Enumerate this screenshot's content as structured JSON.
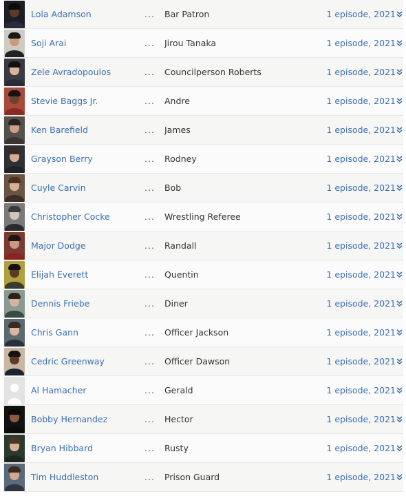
{
  "cast": [
    {
      "name": "Lola Adamson",
      "character": "Bar Patron",
      "episodes": "1 episode, 2021",
      "photo": {
        "bg": "#1e1c24",
        "skin": "#5a3a28",
        "hair": "#0d0b0c",
        "clothes": "#2a2a3a"
      }
    },
    {
      "name": "Soji Arai",
      "character": "Jirou Tanaka",
      "episodes": "1 episode, 2021",
      "photo": {
        "bg": "#cfcac4",
        "skin": "#c79c7a",
        "hair": "#1b1715",
        "clothes": "#222222"
      }
    },
    {
      "name": "Zele Avradopoulos",
      "character": "Councilperson Roberts",
      "episodes": "1 episode, 2021",
      "photo": {
        "bg": "#3a3a42",
        "skin": "#d8b49a",
        "hair": "#111114",
        "clothes": "#2b2b33"
      }
    },
    {
      "name": "Stevie Baggs Jr.",
      "character": "Andre",
      "episodes": "1 episode, 2021",
      "photo": {
        "bg": "#a84a3c",
        "skin": "#6b4430",
        "hair": "#1a1210",
        "clothes": "#8a2a22"
      }
    },
    {
      "name": "Ken Barefield",
      "character": "James",
      "episodes": "1 episode, 2021",
      "photo": {
        "bg": "#54504c",
        "skin": "#c8a288",
        "hair": "#2a221c",
        "clothes": "#3a3633"
      }
    },
    {
      "name": "Grayson Berry",
      "character": "Rodney",
      "episodes": "1 episode, 2021",
      "photo": {
        "bg": "#2e3034",
        "skin": "#d2ad92",
        "hair": "#3a2a20",
        "clothes": "#202226"
      }
    },
    {
      "name": "Cuyle Carvin",
      "character": "Bob",
      "episodes": "1 episode, 2021",
      "photo": {
        "bg": "#6a5444",
        "skin": "#d6b096",
        "hair": "#4a3020",
        "clothes": "#3c2e26"
      }
    },
    {
      "name": "Christopher Cocke",
      "character": "Wrestling Referee",
      "episodes": "1 episode, 2021",
      "photo": {
        "bg": "#7a7a7a",
        "skin": "#cfc6bf",
        "hair": "#3a3a3a",
        "clothes": "#2a2a2a"
      }
    },
    {
      "name": "Major Dodge",
      "character": "Randall",
      "episodes": "1 episode, 2021",
      "photo": {
        "bg": "#7a3a34",
        "skin": "#c99a80",
        "hair": "#1e1410",
        "clothes": "#8c2420"
      }
    },
    {
      "name": "Elijah Everett",
      "character": "Quentin",
      "episodes": "1 episode, 2021",
      "photo": {
        "bg": "#b0a040",
        "skin": "#5a3a26",
        "hair": "#141010",
        "clothes": "#3a3a30"
      }
    },
    {
      "name": "Dennis Friebe",
      "character": "Diner",
      "episodes": "1 episode, 2021",
      "photo": {
        "bg": "#8a9a8e",
        "skin": "#d6b4a0",
        "hair": "#2c2218",
        "clothes": "#3a4a44"
      }
    },
    {
      "name": "Chris Gann",
      "character": "Officer Jackson",
      "episodes": "1 episode, 2021",
      "photo": {
        "bg": "#5a6a70",
        "skin": "#d8b6a0",
        "hair": "#3a2a20",
        "clothes": "#2a3038"
      }
    },
    {
      "name": "Cedric Greenway",
      "character": "Officer Dawson",
      "episodes": "1 episode, 2021",
      "photo": {
        "bg": "#c7b8a6",
        "skin": "#5b3b28",
        "hair": "#1a120e",
        "clothes": "#1e2330"
      }
    },
    {
      "name": "Al Hamacher",
      "character": "Gerald",
      "episodes": "1 episode, 2021",
      "photo": null
    },
    {
      "name": "Bobby Hernandez",
      "character": "Hector",
      "episodes": "1 episode, 2021",
      "photo": {
        "bg": "#121212",
        "skin": "#8a5a40",
        "hair": "#0a0a0a",
        "clothes": "#0c0c0c"
      }
    },
    {
      "name": "Bryan Hibbard",
      "character": "Rusty",
      "episodes": "1 episode, 2021",
      "photo": {
        "bg": "#2a3a2e",
        "skin": "#d8b09a",
        "hair": "#4a3426",
        "clothes": "#1e2620"
      }
    },
    {
      "name": "Tim Huddleston",
      "character": "Prison Guard",
      "episodes": "1 episode, 2021",
      "photo": {
        "bg": "#5a6a7a",
        "skin": "#d2a890",
        "hair": "#3a2a22",
        "clothes": "#2e3440"
      }
    }
  ]
}
